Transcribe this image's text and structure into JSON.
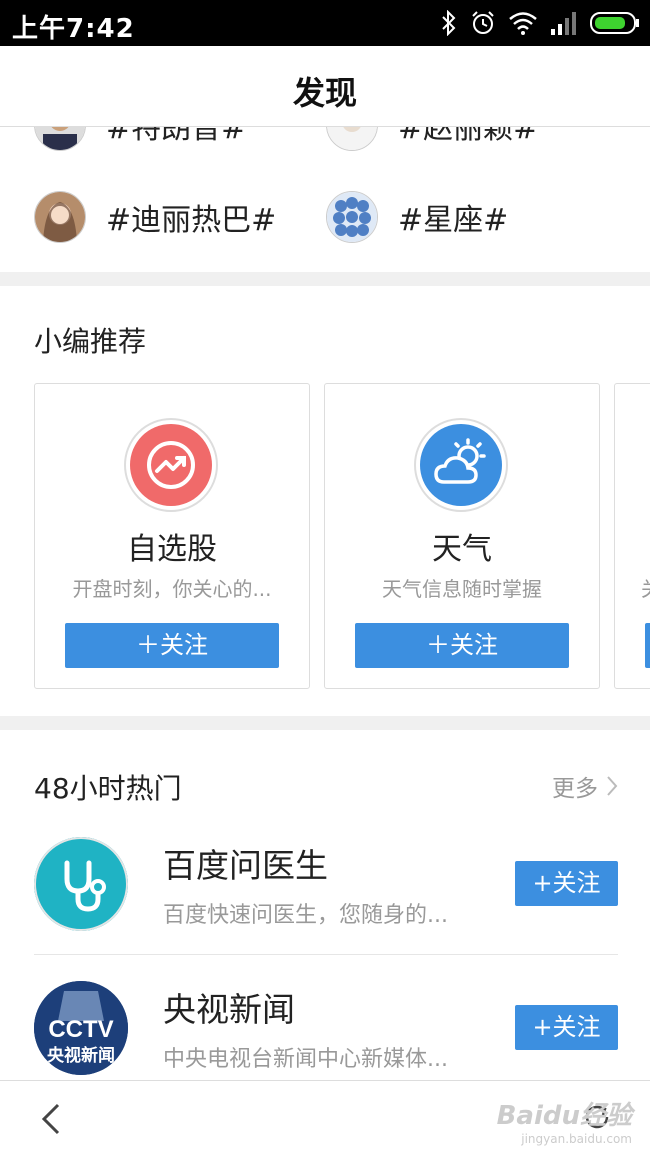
{
  "status_bar": {
    "time": "上午7:42"
  },
  "header": {
    "title": "发现"
  },
  "topics": [
    {
      "label": "#特朗普#"
    },
    {
      "label": "#赵丽颖#"
    },
    {
      "label": "#迪丽热巴#"
    },
    {
      "label": "#星座#"
    }
  ],
  "recommend": {
    "title": "小编推荐",
    "cards": [
      {
        "name": "自选股",
        "desc": "开盘时刻，你关心的...",
        "button": "＋关注",
        "icon": "stock-chart-icon",
        "color": "#f06a6a"
      },
      {
        "name": "天气",
        "desc": "天气信息随时掌握",
        "button": "＋关注",
        "icon": "weather-icon",
        "color": "#3c8fe0"
      },
      {
        "name": "",
        "desc": "关",
        "button": "",
        "icon": "",
        "color": "#3c8fe0"
      }
    ]
  },
  "hot": {
    "title": "48小时热门",
    "more_label": "更多",
    "items": [
      {
        "name": "百度问医生",
        "desc": "百度快速问医生，您随身的...",
        "button": "+关注",
        "icon": "stethoscope-icon",
        "color": "#1fb3c4"
      },
      {
        "name": "央视新闻",
        "desc": "中央电视台新闻中心新媒体...",
        "button": "+关注",
        "icon": "cctv-logo",
        "logo_text": "CCTV",
        "logo_sub": "央视新闻"
      }
    ]
  },
  "watermark": {
    "text": "Baidu经验",
    "sub": "jingyan.baidu.com"
  }
}
